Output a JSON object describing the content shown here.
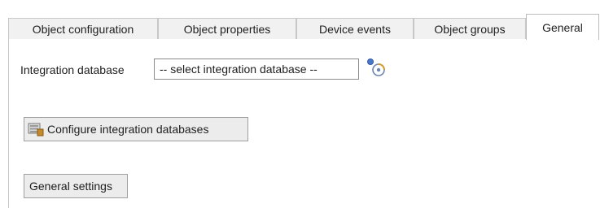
{
  "tabs": [
    {
      "label": "Object configuration",
      "active": false
    },
    {
      "label": "Object properties",
      "active": false
    },
    {
      "label": "Device events",
      "active": false
    },
    {
      "label": "Object groups",
      "active": false
    },
    {
      "label": "General",
      "active": true
    }
  ],
  "general": {
    "integration_database_label": "Integration database",
    "integration_database_value": "-- select integration database --",
    "configure_button_label": "Configure integration databases",
    "general_settings_button_label": "General settings"
  },
  "icons": {
    "refresh": "refresh-icon",
    "configure": "database-config-icon"
  },
  "colors": {
    "tab_inactive_bg": "#f1f1f1",
    "tab_active_bg": "#ffffff",
    "button_bg": "#ececec",
    "border": "#c8c8c8"
  }
}
